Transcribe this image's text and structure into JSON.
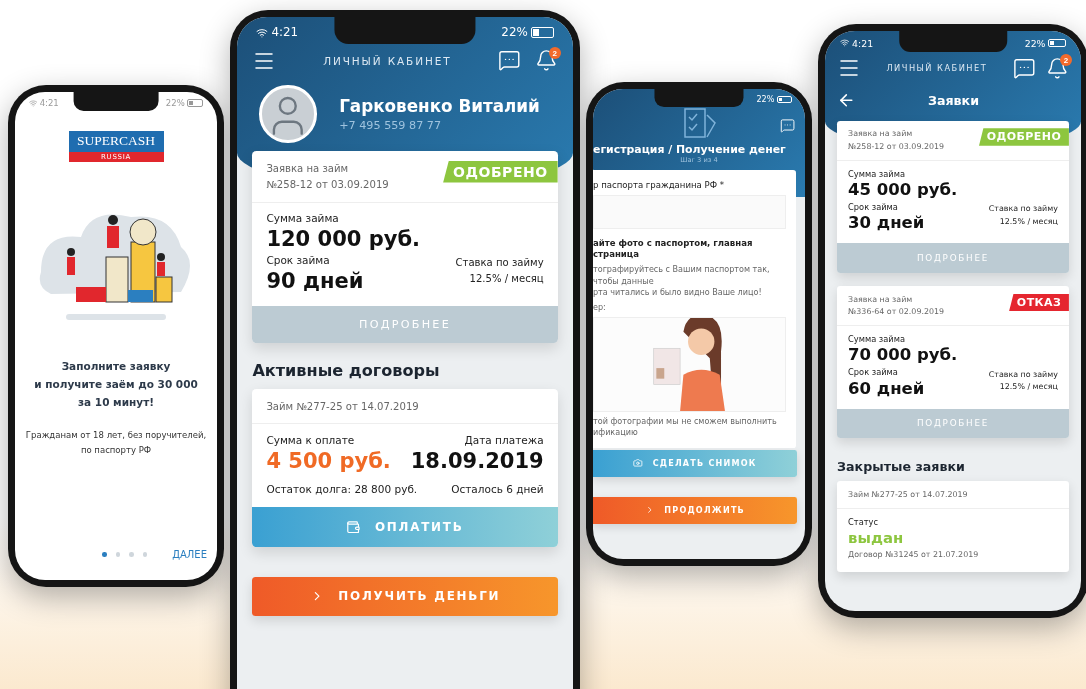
{
  "phones": [
    {
      "kind": "onboarding",
      "status_bar": {
        "time": "4:21",
        "battery": "22%"
      },
      "logo": {
        "title": "SUPERCASH",
        "subtitle": "RUSSIA"
      },
      "headline": "Заполните заявку\nи получите заём до 30 000\nза 10 минут!",
      "subtext": "Гражданам от 18 лет, без поручителей,\nпо паспорту РФ",
      "dots": [
        {
          "selected": true
        },
        {
          "selected": false
        },
        {
          "selected": false
        },
        {
          "selected": false
        }
      ],
      "next": "ДАЛЕЕ"
    },
    {
      "kind": "profile",
      "status_bar": {
        "time": "4:21",
        "battery": "22%"
      },
      "header": {
        "title": "ЛИЧНЫЙ КАБИНЕТ",
        "badge": "2"
      },
      "user": {
        "name": "Гарковенко Виталий",
        "phone": "+7 495 559 87 77"
      },
      "applications": [
        {
          "label": "Заявка на займ",
          "number": "№258-12 от 03.09.2019",
          "status": {
            "kind": "approved",
            "text": "ОДОБРЕНО"
          },
          "amount_label": "Сумма займа",
          "amount": "120 000 руб.",
          "term_label": "Срок займа",
          "term": "90 дней",
          "rate_label": "Ставка по займу",
          "rate": "12.5% / месяц",
          "button": "ПОДРОБНЕЕ"
        }
      ],
      "section_title": "Активные договоры",
      "contract": {
        "header": "Займ №277-25 от 14.07.2019",
        "due_label": "Сумма к оплате",
        "due": "4 500 руб.",
        "date_label": "Дата платежа",
        "date": "18.09.2019",
        "balance": "Остаток долга: 28 800 руб.",
        "remaining": "Осталось 6 дней",
        "button": "ОПЛАТИТЬ"
      },
      "action": "ПОЛУЧИТЬ ДЕНЬГИ"
    },
    {
      "kind": "registration",
      "status_bar": {
        "battery": "22%"
      },
      "title": "егистрация / Получение денег",
      "step": "Шаг 3 из 4",
      "field_label": "р паспорта гражданина РФ *",
      "photo_title": "айте фото с паспортом, главная страница",
      "hint": "тографируйтесь с Вашим паспортом так, чтобы данные\nрта читались и было видно Ваше лицо!",
      "example_label": "ер:",
      "warning": "той фотографии мы не сможем выполнить\nификацию",
      "photo_button": "СДЕЛАТЬ СНИМОК",
      "continue": "ПРОДОЛЖИТЬ"
    },
    {
      "kind": "requests",
      "status_bar": {
        "time": "4:21",
        "battery": "22%"
      },
      "header": {
        "title": "ЛИЧНЫЙ КАБИНЕТ",
        "badge": "2"
      },
      "page_title": "Заявки",
      "applications": [
        {
          "label": "Заявка на займ",
          "number": "№258-12 от 03.09.2019",
          "status": {
            "kind": "approved",
            "text": "ОДОБРЕНО"
          },
          "amount_label": "Сумма займа",
          "amount": "45 000 руб.",
          "term_label": "Срок займа",
          "term": "30 дней",
          "rate_label": "Ставка по займу",
          "rate": "12.5% / месяц",
          "button": "ПОДРОБНЕЕ"
        },
        {
          "label": "Заявка на займ",
          "number": "№336-64 от 02.09.2019",
          "status": {
            "kind": "rejected",
            "text": "ОТКАЗ"
          },
          "amount_label": "Сумма займа",
          "amount": "70 000 руб.",
          "term_label": "Срок займа",
          "term": "60 дней",
          "rate_label": "Ставка по займу",
          "rate": "12.5% / месяц",
          "button": "ПОДРОБНЕЕ"
        }
      ],
      "section_title": "Закрытые заявки",
      "closed": {
        "header": "Займ №277-25 от 14.07.2019",
        "status_label": "Статус",
        "status": "выдан",
        "contract": "Договор №31245 от 21.07.2019"
      }
    }
  ]
}
